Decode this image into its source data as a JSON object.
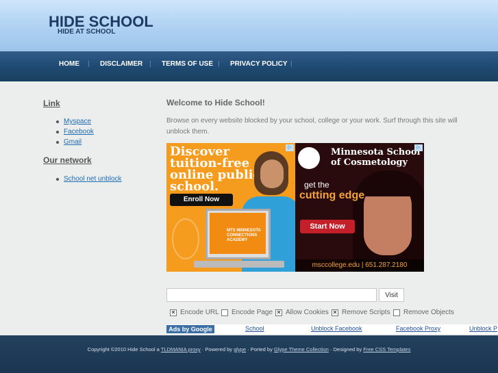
{
  "header": {
    "title": "HIDE SCHOOL",
    "tagline": "HIDE AT SCHOOL"
  },
  "nav": {
    "items": [
      "HOME",
      "DISCLAIMER",
      "TERMS OF USE",
      "PRIVACY POLICY"
    ],
    "separator": "|"
  },
  "sidebar": {
    "link_title": "Link",
    "links": [
      "Myspace",
      "Facebook",
      "Gmail"
    ],
    "network_title": "Our network",
    "network_links": [
      "School net unblock"
    ]
  },
  "main": {
    "welcome_title": "Welcome to Hide School!",
    "welcome_text": "Browse on every website blocked by your school, college or your work. Surf through this site will unblock them."
  },
  "ads": {
    "left": {
      "headline": "Discover tuition-free online public school.",
      "button": "Enroll Now",
      "laptop_text": "MTS MINNESOTA CONNECTIONS ACADEMY",
      "choice_icon": "ad-choices-icon"
    },
    "right": {
      "logo": "Minnesota School of Cosmetology",
      "tag1": "get the",
      "tag2": "cutting edge",
      "button": "Start Now",
      "url": "msccollege.edu | 651.287.2180",
      "choice_icon": "ad-choices-icon"
    }
  },
  "form": {
    "url_value": "",
    "visit_label": "Visit",
    "options": [
      {
        "label": "Encode URL",
        "checked": true
      },
      {
        "label": "Encode Page",
        "checked": false
      },
      {
        "label": "Allow Cookies",
        "checked": true
      },
      {
        "label": "Remove Scripts",
        "checked": true
      },
      {
        "label": "Remove Objects",
        "checked": false
      }
    ]
  },
  "link_unit": {
    "badge": "Ads by Google",
    "links": [
      "School",
      "Unblock Facebook",
      "Facebook Proxy",
      "Unblock P"
    ]
  },
  "footer": {
    "prefix": "Copyright ©2010 Hide School a",
    "link1": "TLDMANIA proxy",
    "part2": " · Powered by ",
    "link2": "glype",
    "part3": " · Ported by ",
    "link3": "Glype Theme Collection",
    "part4": " · Designed by ",
    "link4": "Free CSS Templates"
  },
  "colors": {
    "header_gradient_top": "#cfe6fb",
    "nav_bg": "#1f4a73",
    "link_blue": "#1f6bb3",
    "footer_bg": "#1a3550"
  }
}
